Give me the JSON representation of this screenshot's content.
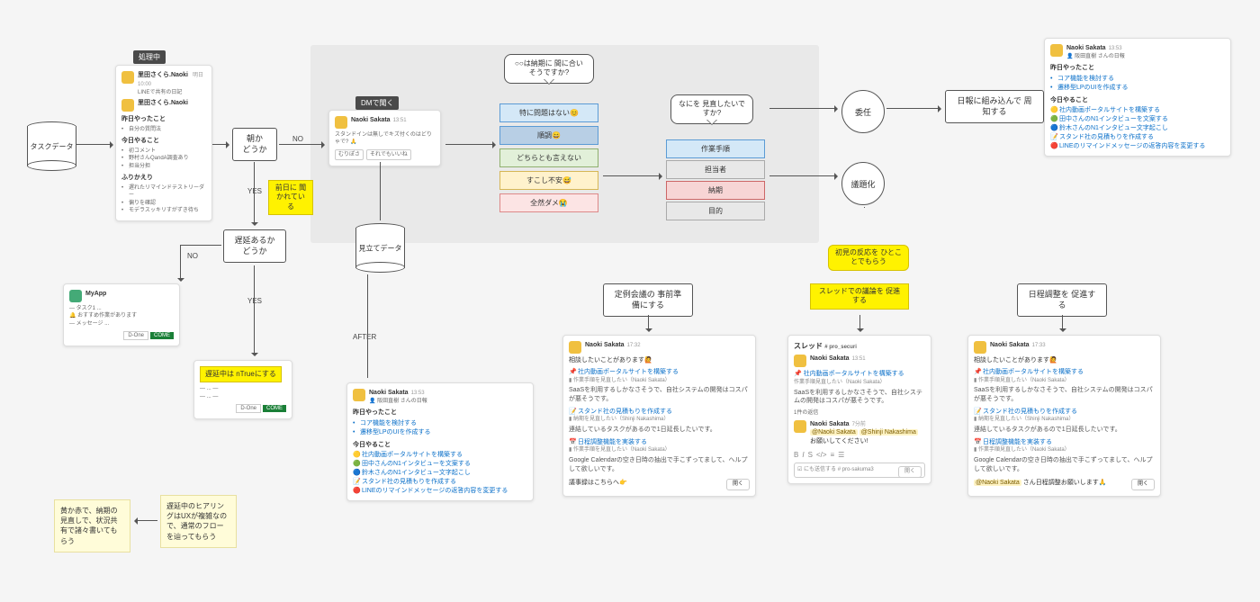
{
  "tags": {
    "processing": "処理中"
  },
  "cylinders": {
    "task_data": "タスクデータ",
    "estimate_data": "見立てデータ"
  },
  "decisions": {
    "morning": "朝か\nどうか",
    "delayed": "遅延あるか\nどうか"
  },
  "labels": {
    "no": "NO",
    "yes": "YES",
    "after": "AFTER",
    "asked_prev_day": "前日に\n聞かれている",
    "dm_ask": "DMで聞く"
  },
  "bubbles": {
    "on_time": "○○は納期に\n間に合いそうですか?",
    "revise_what": "なにを\n見直したいですか?",
    "first_reaction": "初見の反応を\nひとことでもらう"
  },
  "options_status": [
    {
      "label": "特に問題はない😊",
      "cls": "blue"
    },
    {
      "label": "順調😄",
      "cls": "bluegrey"
    },
    {
      "label": "どちらとも言えない",
      "cls": "green"
    },
    {
      "label": "すこし不安😅",
      "cls": "yellow"
    },
    {
      "label": "全然ダメ😭",
      "cls": "pink"
    }
  ],
  "options_revise": [
    {
      "label": "作業手順",
      "cls": "blue"
    },
    {
      "label": "担当者",
      "cls": "grey"
    },
    {
      "label": "納期",
      "cls": "red"
    },
    {
      "label": "目的",
      "cls": "grey"
    }
  ],
  "circles": {
    "delegate": "委任",
    "issue": "議題化"
  },
  "nodes": {
    "report": "日報に組み込んで\n周知する",
    "meeting_prep": "定例会議の\n事前準備にする",
    "thread_push": "スレッドでの議論を\n促進する",
    "schedule_push": "日程調整を\n促進する"
  },
  "stickies": {
    "left1": "黄か赤で、納期の見直しで、状況共有で諸々書いてもらう",
    "left2": "遅延中のヒアリングはUXが複雑なので、通常のフローを辿ってもらう",
    "mid": "遅延中は\nnTrueにする"
  },
  "slack_dm": {
    "name": "Naoki Sakata",
    "time": "13:51",
    "line": "スタンドインは無しでキズ付くのはどりゃで? 🙏",
    "reply1": "むりぽさ",
    "reply2": "それでもいいね"
  },
  "slack_report_small": {
    "name": "Naoki Sakata",
    "time": "13:53",
    "header_line": "阪田直樹 さんの日報",
    "sec1": "昨日やったこと",
    "items1": [
      "コア機能を検討する",
      "遷移型LPのUIを作成する"
    ],
    "sec2": "今日やること",
    "items2_a": [
      "社内動画ポータルサイトを構築する",
      "田中さんのN1インタビューを文案する"
    ],
    "items2_b": [
      "鈴木さんのN1インタビュー文字起こし",
      "スタンド社の見積もりを作成する",
      "LINEのリマインドメッセージの返答内容を変更する"
    ]
  },
  "slack_meeting": {
    "name": "Naoki Sakata",
    "time": "17:32",
    "title": "相談したいことがあります🙋",
    "tasks": [
      {
        "icon": "📌",
        "title": "社内動画ポータルサイトを構築する",
        "meta": "作業手順を見直したい（Naoki Sakata）",
        "body": "SaaSを利用するしかなさそうで、自社システムの開発はコスパが悪そうです。"
      },
      {
        "icon": "📝",
        "title": "スタンド社の見積もりを作成する",
        "meta": "納期を見直したい（Shinji Nakashima）",
        "body": "連結しているタスクがあるので1日延長したいです。"
      },
      {
        "icon": "📅",
        "title": "日程調整機能を実装する",
        "meta": "作業手順を見直したい（Naoki Sakata）",
        "body": "Google Calendarの空き日時の抽出で手こずってまして、ヘルプして欲しいです。"
      }
    ],
    "footer": "議事録はこちらへ👉",
    "btn": "開く"
  },
  "slack_thread": {
    "title": "スレッド",
    "channel": "# pro_securi",
    "name": "Naoki Sakata",
    "time": "13:51",
    "task_title": "社内動画ポータルサイトを構築する",
    "meta": "作業手順見直したい（Naoki Sakata）",
    "body": "SaaSを利用するしかなさそうで、自社システムの開発はコスパが悪そうです。",
    "replies_label": "1件の返信",
    "reply_name": "Naoki Sakata",
    "reply_time": "7分前",
    "reply_body": "お願いしてください!",
    "mentions": [
      "@Naoki Sakata",
      "@Shinji Nakashima"
    ],
    "input_placeholder": "にも送信する # pro-sakuma3",
    "btn": "開く"
  },
  "slack_schedule": {
    "name": "Naoki Sakata",
    "time": "17:33",
    "title": "相談したいことがあります🙋",
    "tasks": [
      {
        "icon": "📌",
        "title": "社内動画ポータルサイトを構築する",
        "meta": "作業手順見直したい（Naoki Sakata）",
        "body": "SaaSを利用するしかなさそうで、自社システムの開発はコスパが悪そうです。"
      },
      {
        "icon": "📝",
        "title": "スタンド社の見積もりを作成する",
        "meta": "納期を見直したい（Shinji Nakashima）",
        "body": "連結しているタスクがあるので1日延長したいです。"
      },
      {
        "icon": "📅",
        "title": "日程調整機能を実装する",
        "meta": "作業手順見直したい（Naoki Sakata）",
        "body": "Google Calendarの空き日時の抽出で手こずってまして、ヘルプして欲しいです。"
      }
    ],
    "footer_mention": "@Naoki Sakata",
    "footer_text": " さん日程調整お願いします🙏",
    "btn": "開く"
  },
  "slack_app": {
    "name": "MyApp",
    "lines": [
      "— タスク1 ...",
      "🔔 おすすめ作業があります",
      "— メッセージ ..."
    ],
    "btn1": "D-One",
    "btn2": "COME"
  },
  "slack_left": {
    "name": "里田さくら.Naoki",
    "time_suffix": "明日 10:00",
    "line0": "LINEで共有の日記",
    "sec1": "昨日やったこと",
    "items1": [
      "自分の質問法"
    ],
    "sec2": "今日やること",
    "items2": [
      "初コメント",
      "野村さんQandA調査あり",
      "担当分担"
    ],
    "sec3": "ふりかえり",
    "items3": [
      "遅れたリマインドテストリーダー",
      "偏りを確認",
      "モデラスッキリすがずき待ち"
    ]
  }
}
